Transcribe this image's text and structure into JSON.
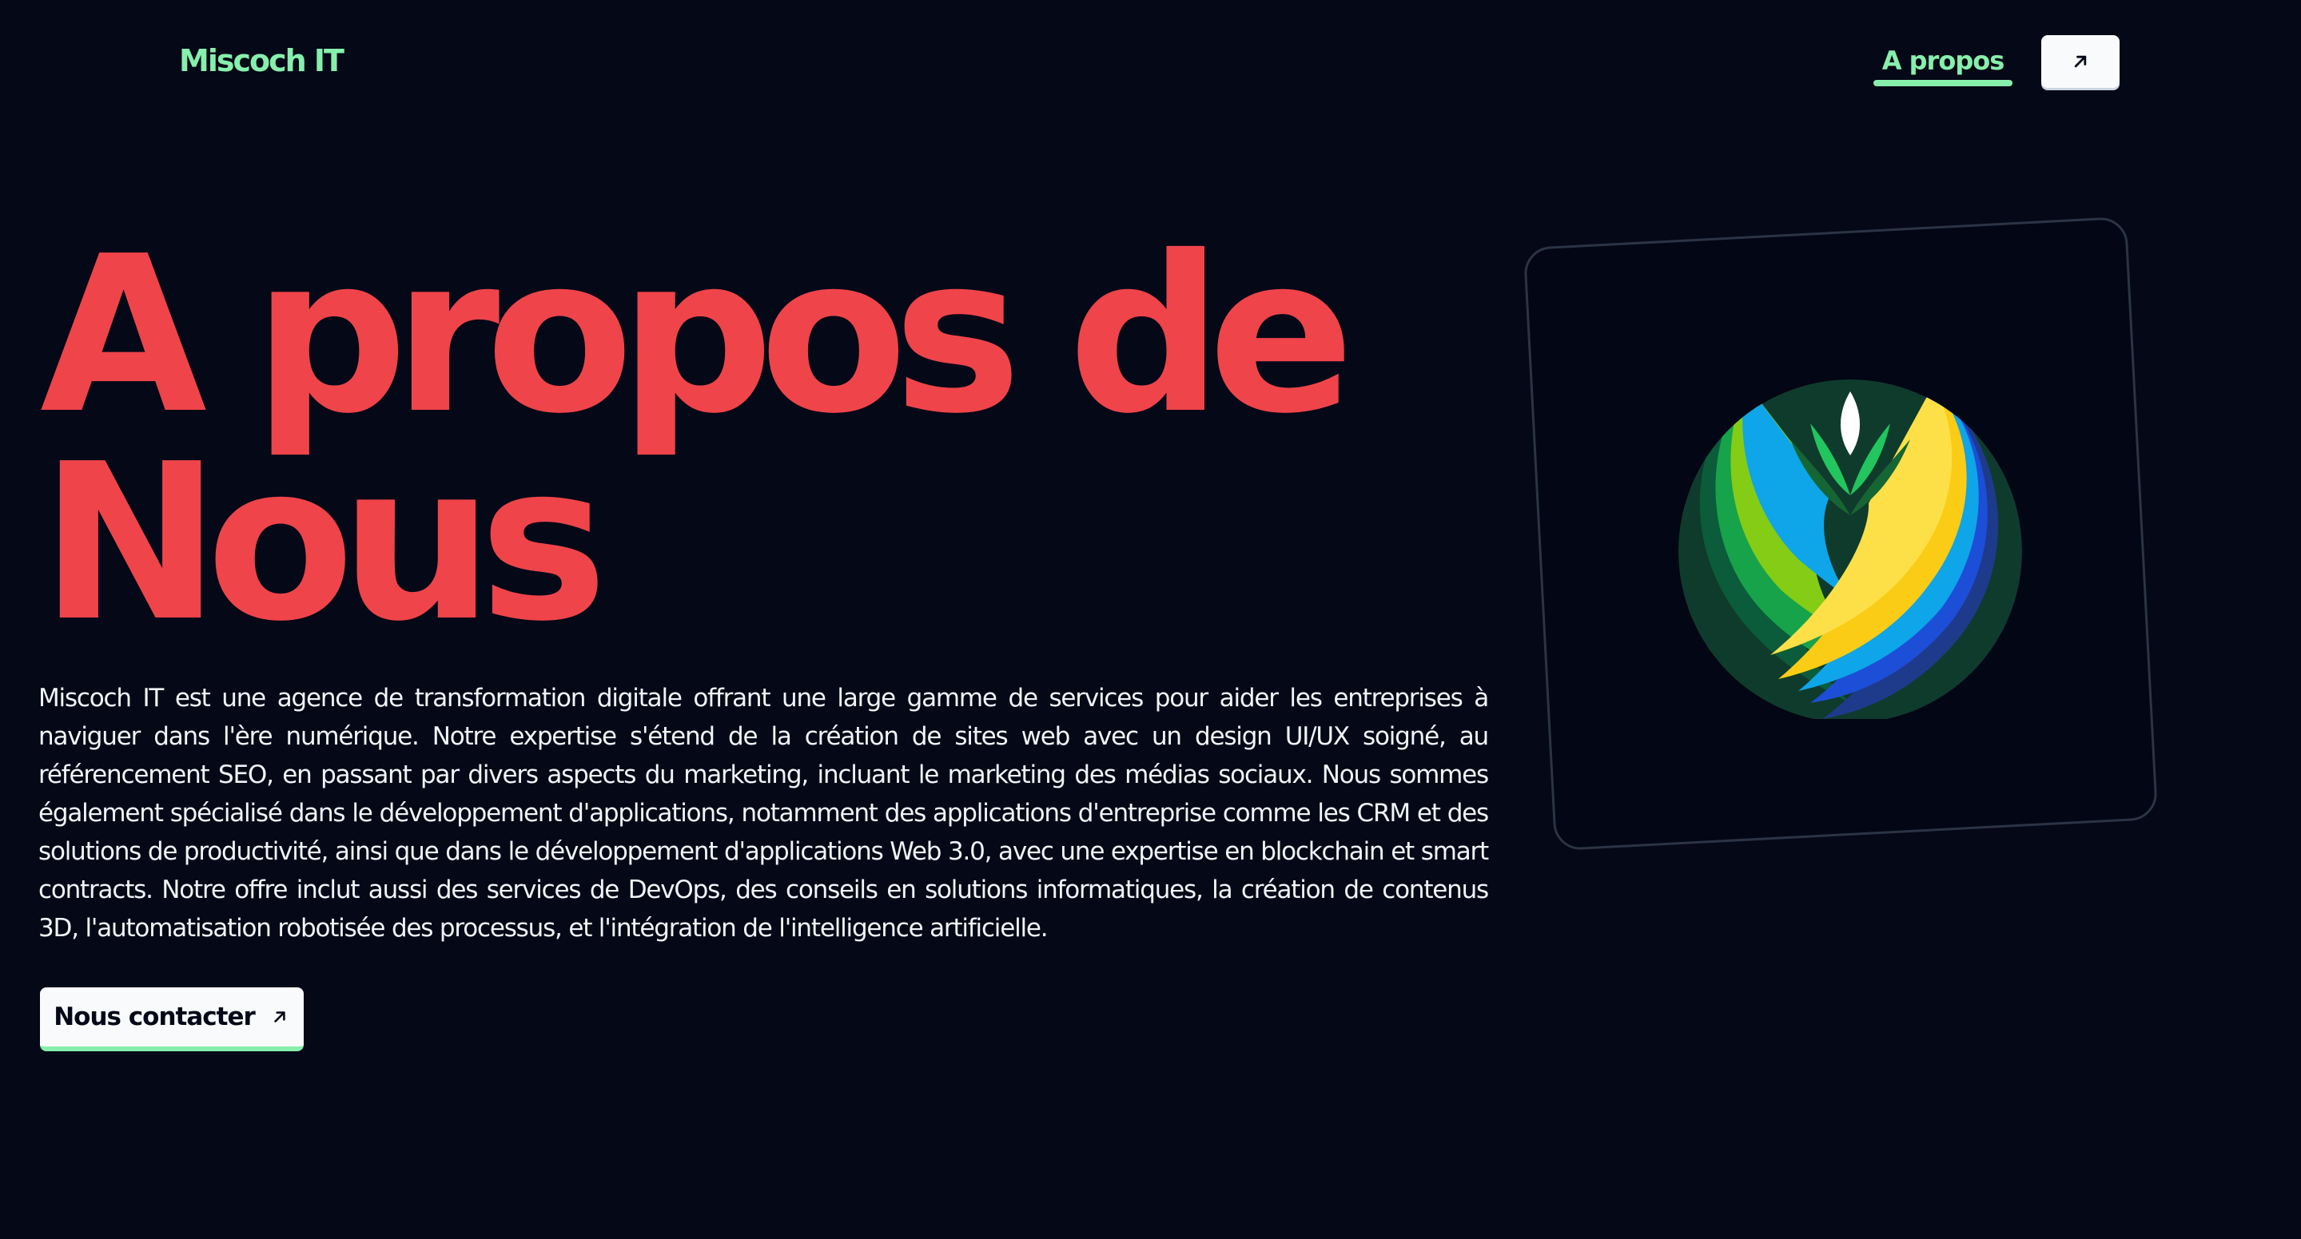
{
  "header": {
    "brand": "Miscoch IT",
    "nav_link_label": "A propos",
    "external_icon": "arrow-up-right-icon"
  },
  "hero": {
    "title_line1": "A propos de",
    "title_line2": "Nous",
    "description": "Miscoch IT est une agence de transformation digitale offrant une large gamme de services pour aider les entreprises à naviguer dans l'ère numérique. Notre expertise s'étend de la création de sites web avec un design UI/UX soigné, au référencement SEO, en passant par divers aspects du marketing, incluant le marketing des médias sociaux. Nous sommes également spécialisé dans le développement d'applications, notamment des applications d'entreprise comme les CRM et des solutions de productivité, ainsi que dans le développement d'applications Web 3.0, avec une expertise en blockchain et smart contracts. Notre offre inclut aussi des services de DevOps, des conseils en solutions informatiques, la création de contenus 3D, l'automatisation robotisée des processus, et l'intégration de l'intelligence artificielle.",
    "contact_label": "Nous contacter",
    "contact_icon": "arrow-up-right-icon"
  },
  "colors": {
    "background": "#050816",
    "accent_green": "#86efac",
    "title_red": "#ef444a",
    "button_bg": "#f8fafc"
  }
}
